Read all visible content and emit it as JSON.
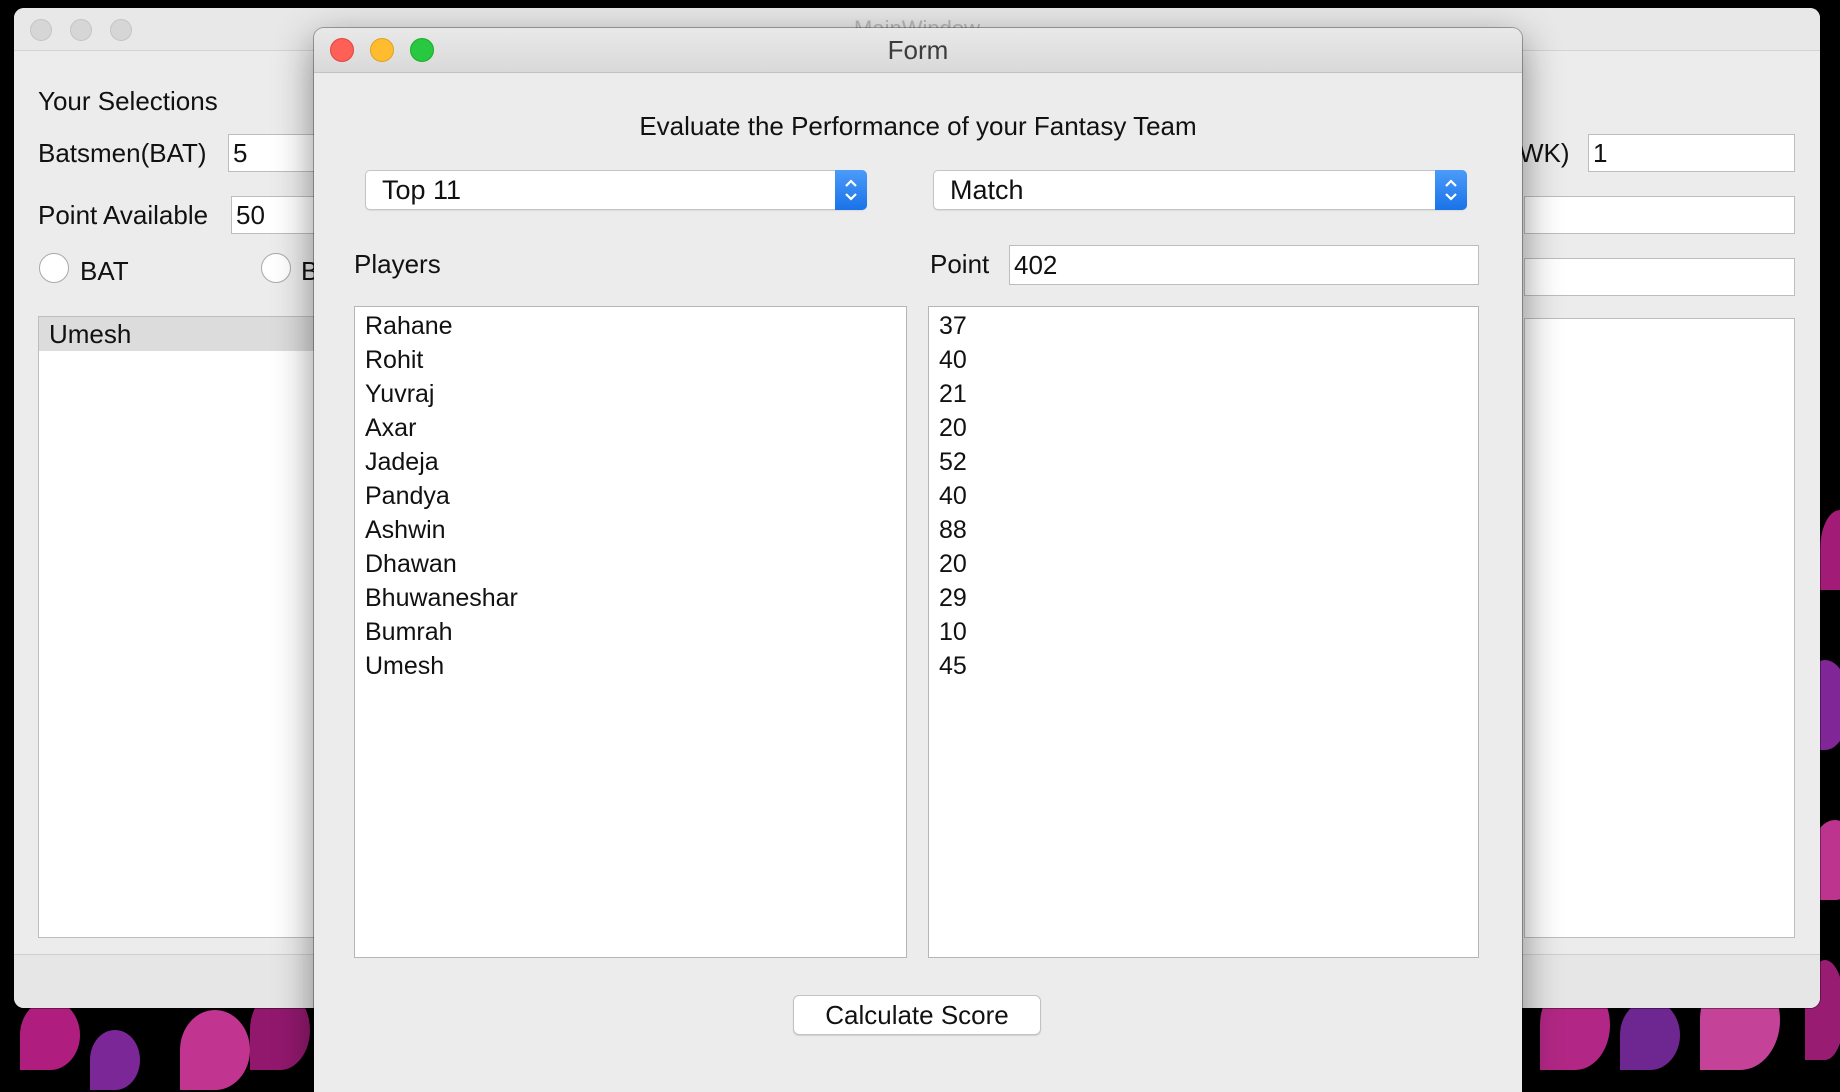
{
  "main_window": {
    "title": "MainWindow",
    "your_selections_label": "Your Selections",
    "batsmen_label": "Batsmen(BAT)",
    "batsmen_value": "5",
    "point_available_label": "Point Available",
    "point_available_value": "50",
    "wk_label": "WK)",
    "wk_value": "1",
    "radio_bat_label": "BAT",
    "radio_second_label": "B",
    "selected_list": [
      "Umesh"
    ]
  },
  "form": {
    "title": "Form",
    "heading": "Evaluate the Performance of your Fantasy Team",
    "team_select": "Top 11",
    "match_select": "Match",
    "players_label": "Players",
    "point_label": "Point",
    "point_value": "402",
    "players": [
      "Rahane",
      "Rohit",
      "Yuvraj",
      "Axar",
      "Jadeja",
      "Pandya",
      "Ashwin",
      "Dhawan",
      "Bhuwaneshar",
      "Bumrah",
      "Umesh"
    ],
    "points": [
      "37",
      "40",
      "21",
      "20",
      "52",
      "40",
      "88",
      "20",
      "29",
      "10",
      "45"
    ],
    "calculate_button": "Calculate Score"
  },
  "colors": {
    "close": "#fe5f57",
    "minimize": "#febc2e",
    "maximize": "#28c840",
    "combo_accent": "#1a73e8"
  }
}
